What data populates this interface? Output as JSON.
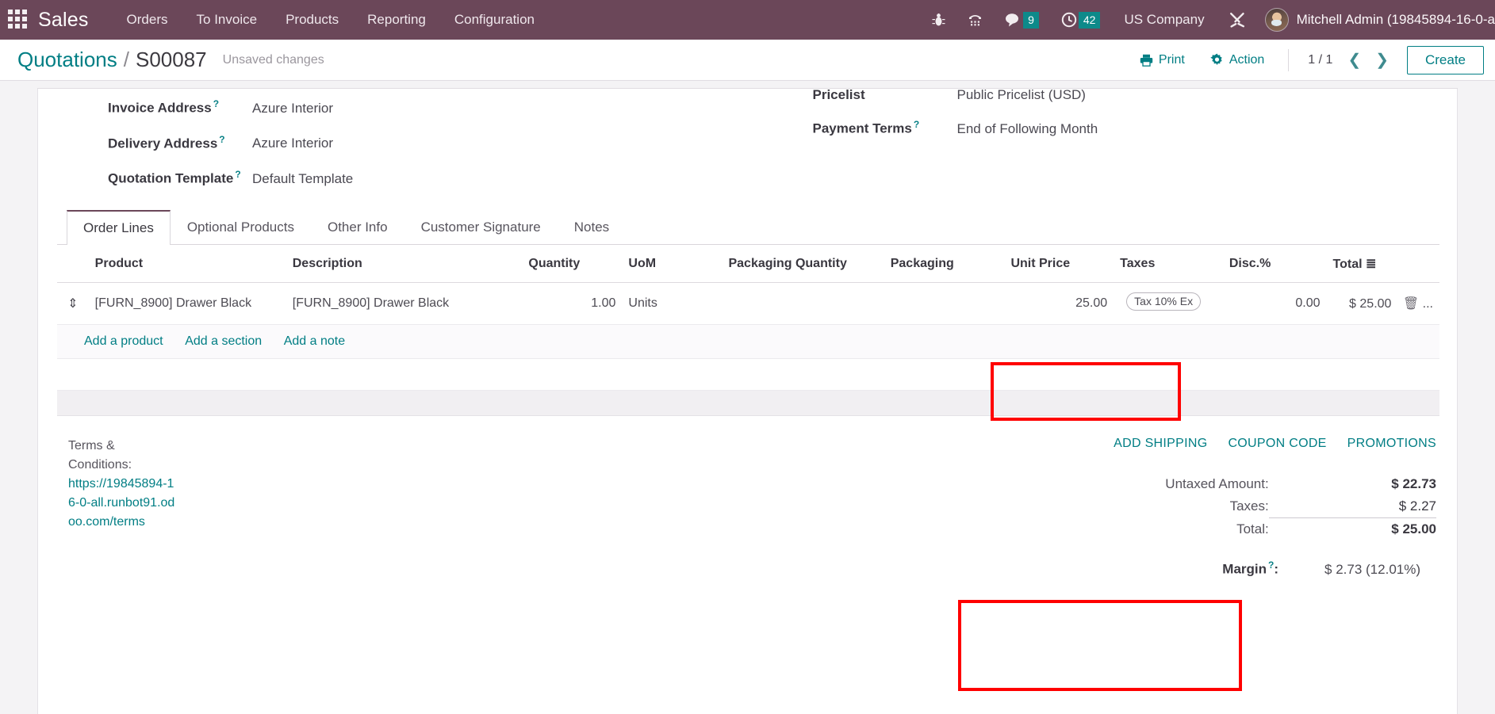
{
  "navbar": {
    "apps_icon": "apps-grid-icon",
    "brand": "Sales",
    "menu": [
      "Orders",
      "To Invoice",
      "Products",
      "Reporting",
      "Configuration"
    ],
    "icons": [
      {
        "name": "bug-icon",
        "glyph": "debug"
      },
      {
        "name": "phone-dialpad-icon",
        "glyph": "voip"
      }
    ],
    "messages": {
      "icon": "chat-bubble-icon",
      "count": "9"
    },
    "activities": {
      "icon": "clock-icon",
      "count": "42"
    },
    "company": "US Company",
    "tools_icon": "wrench-screwdriver-icon",
    "user": "Mitchell Admin (19845894-16-0-a",
    "accent": "#6b4759",
    "badge_color": "#0d8a8a"
  },
  "control_panel": {
    "breadcrumb_root": "Quotations",
    "breadcrumb_sep": "/",
    "breadcrumb_current": "S00087",
    "dirty_status": "Unsaved changes",
    "print_label": "Print",
    "print_icon": "printer-icon",
    "action_label": "Action",
    "action_icon": "gear-icon",
    "pager": "1 / 1",
    "prev_icon": "chevron-left-icon",
    "next_icon": "chevron-right-icon",
    "create_label": "Create",
    "accent": "#017e84"
  },
  "form": {
    "left_fields": [
      {
        "label": "Invoice Address",
        "tooltip": "?",
        "value": "Azure Interior"
      },
      {
        "label": "Delivery Address",
        "tooltip": "?",
        "value": "Azure Interior"
      },
      {
        "label": "Quotation Template",
        "tooltip": "?",
        "value": "Default Template"
      }
    ],
    "right_fields": [
      {
        "label": "Pricelist",
        "tooltip": "",
        "value": "Public Pricelist (USD)"
      },
      {
        "label": "Payment Terms",
        "tooltip": "?",
        "value": "End of Following Month"
      }
    ]
  },
  "notebook": {
    "tabs": [
      {
        "label": "Order Lines",
        "active": true
      },
      {
        "label": "Optional Products",
        "active": false
      },
      {
        "label": "Other Info",
        "active": false
      },
      {
        "label": "Customer Signature",
        "active": false
      },
      {
        "label": "Notes",
        "active": false
      }
    ]
  },
  "order_lines": {
    "columns": [
      "",
      "Product",
      "Description",
      "Quantity",
      "UoM",
      "Packaging Quantity",
      "Packaging",
      "Unit Price",
      "Taxes",
      "Disc.%",
      "Total"
    ],
    "optional_columns_icon": "column-options-icon",
    "rows": [
      {
        "handle_icon": "drag-handle-icon",
        "product": "[FURN_8900] Drawer Black",
        "description": "[FURN_8900] Drawer Black",
        "quantity": "1.00",
        "uom": "Units",
        "packaging_quantity": "",
        "packaging": "",
        "unit_price": "25.00",
        "taxes": "Tax 10% Ex",
        "discount": "0.00",
        "total": "$ 25.00",
        "delete_icon": "trash-icon",
        "overflow": "..."
      }
    ],
    "add_links": [
      "Add a product",
      "Add a section",
      "Add a note"
    ]
  },
  "bottom": {
    "terms_label": "Terms & Conditions:",
    "terms_url": "https://19845894-16-0-all.runbot91.odoo.com/terms",
    "promo_links": [
      "ADD SHIPPING",
      "COUPON CODE",
      "PROMOTIONS"
    ],
    "totals": [
      {
        "label": "Untaxed Amount:",
        "value": "$ 22.73",
        "bold": true
      },
      {
        "label": "Taxes:",
        "value": "$ 2.27",
        "bold": false
      },
      {
        "label": "Total:",
        "value": "$ 25.00",
        "bold": true
      }
    ],
    "margin_label": "Margin",
    "margin_tooltip": "?",
    "margin_colon": ":",
    "margin_value": "$ 2.73 (12.01%)"
  },
  "annotations": {
    "highlight_color": "#ff0000",
    "boxes": [
      "unit-price-taxes-header-and-cell",
      "totals-summary-block"
    ]
  }
}
